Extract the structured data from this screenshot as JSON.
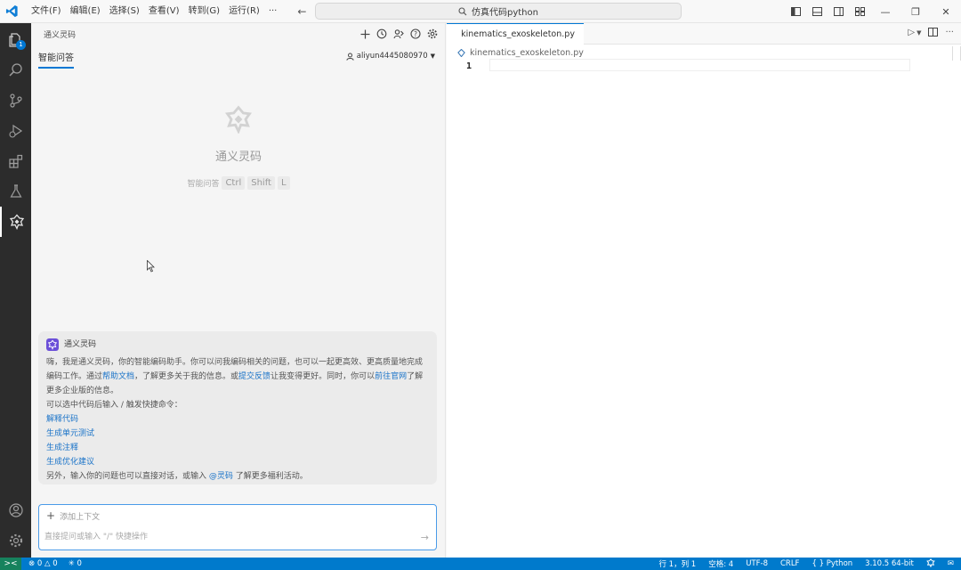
{
  "titlebar": {
    "menus": [
      "文件(F)",
      "编辑(E)",
      "选择(S)",
      "查看(V)",
      "转到(G)",
      "运行(R)",
      "···"
    ],
    "search_text": "仿真代码python"
  },
  "activitybar": {
    "explorer_badge": "1"
  },
  "sidebar": {
    "title": "通义灵码",
    "tab_label": "智能问答",
    "user": "aliyun4445080970",
    "hero": {
      "title": "通义灵码",
      "shortcut_label": "智能问答",
      "keys": [
        "Ctrl",
        "Shift",
        "L"
      ]
    },
    "card": {
      "name": "通义灵码",
      "intro_part1": "嗨，我是通义灵码，你的智能编码助手。你可以问我编码相关的问题，也可以一起更高效、更高质量地完成编码工作。通过",
      "help_link": "帮助文档",
      "intro_part2": "，了解更多关于我的信息。或",
      "feedback_link": "提交反馈",
      "intro_part3": "让我变得更好。同时，你可以",
      "site_link": "前往官网",
      "intro_part4": "了解更多企业版的信息。",
      "commands_intro": "可以选中代码后输入 / 触发快捷命令：",
      "commands": [
        "解释代码",
        "生成单元测试",
        "生成注释",
        "生成优化建议"
      ],
      "footer_part1": "另外，输入你的问题也可以直接对话，或输入 ",
      "footer_mention": "@灵码",
      "footer_part2": " 了解更多福利活动。"
    },
    "input": {
      "add_context": "添加上下文",
      "placeholder": "直接提问或输入 \"/\" 快捷操作",
      "value": ""
    }
  },
  "editor": {
    "tab_label": "kinematics_exoskeleton.py",
    "breadcrumb": "kinematics_exoskeleton.py",
    "line_number": "1"
  },
  "statusbar": {
    "errors": "0",
    "warnings": "0",
    "ports": "0",
    "position": "行 1，列 1",
    "spaces": "空格: 4",
    "encoding": "UTF-8",
    "eol": "CRLF",
    "language": "Python",
    "interpreter": "3.10.5 64-bit"
  },
  "colors": {
    "activity_bg": "#2c2c2c",
    "accent": "#0078d4",
    "status_bg": "#007acc",
    "link": "#1a73c8"
  }
}
